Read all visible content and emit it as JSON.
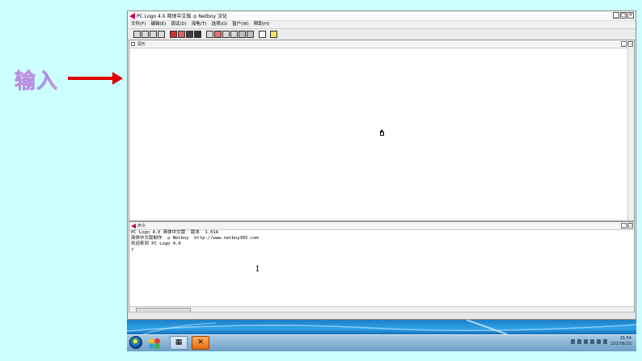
{
  "slide": {
    "input_label": "输入"
  },
  "window": {
    "title": "PC Logo 4.0 简体中文版  ◎ Netboy  汉化",
    "controls": [
      "_",
      "□",
      "×"
    ]
  },
  "menu": [
    "文件(F)",
    "编辑(E)",
    "调试(D)",
    "海龟(T)",
    "选项(O)",
    "窗户(W)",
    "帮助(H)"
  ],
  "toolbar_icons": [
    "open-icon",
    "save-icon",
    "print-icon",
    "copy-icon",
    "stop-icon",
    "turtle-red-icon",
    "pen-icon",
    "erase-icon",
    "zoom-icon",
    "pencolor-icon",
    "fill-icon",
    "run-icon",
    "step-icon",
    "pause-icon",
    "trace-icon",
    "window-icon",
    "help-icon"
  ],
  "drawing_pane": {
    "title": "图形",
    "controls": [
      "_",
      "□"
    ]
  },
  "command_pane": {
    "title": "命令",
    "controls": [
      "_",
      "□"
    ],
    "lines": [
      "PC Logo 4.0 简体中文版  版本  1.01A",
      "简体中文版制作  ◎ Netboy  http://www.netboy365.com",
      "",
      "欢迎来到 PC Logo 4.0",
      "",
      "?"
    ]
  },
  "taskbar": {
    "clock_time": "15:54",
    "clock_date": "2017/6/15",
    "apps": [
      "start-orb",
      "folder-app",
      "logo-app",
      "pptx-app"
    ]
  },
  "colors": {
    "slide_bg": "#ccffff",
    "arrow": "#e00000",
    "taskbar": "#88b4d6"
  }
}
